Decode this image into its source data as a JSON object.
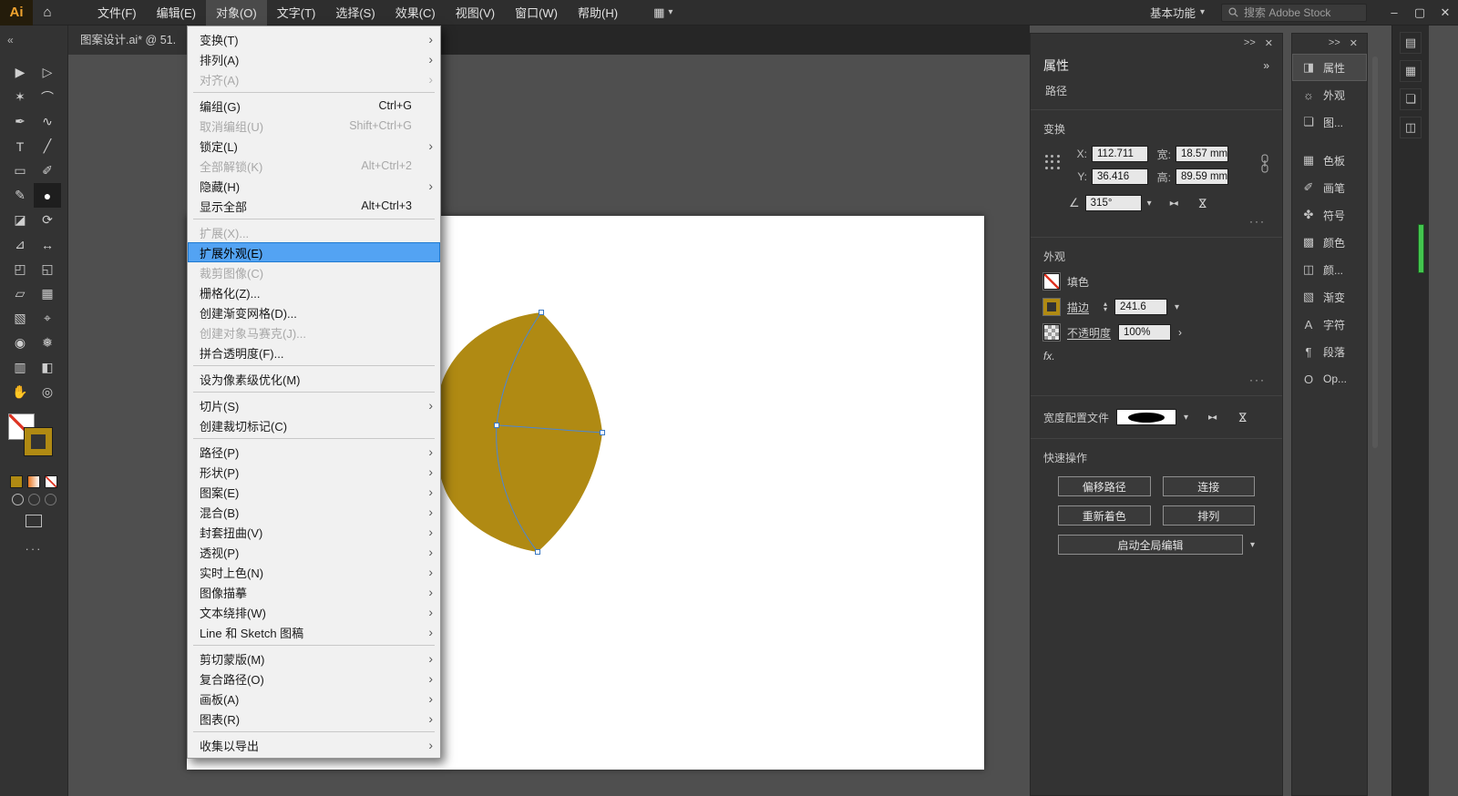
{
  "ui": {
    "caret": "▾",
    "chevron_right": "›",
    "collapse_left": "«",
    "collapse_right": "»",
    "dock_arrows": ">>",
    "close": "✕",
    "more": "···",
    "angle": "∠",
    "flip_h": "▸◂",
    "flip_v": "⋈",
    "stepper_up": "▴",
    "stepper_down": "▾",
    "fx": "fx.",
    "search_icon": "search",
    "submenu_arrow": "›"
  },
  "colors": {
    "shape_gold": "#b08a13",
    "menu_highlight": "#53a3f3",
    "path_blue": "#4a86d8"
  },
  "topbar": {
    "logo": "Ai",
    "home_icon": "⌂",
    "menus": [
      "文件(F)",
      "编辑(E)",
      "对象(O)",
      "文字(T)",
      "选择(S)",
      "效果(C)",
      "视图(V)",
      "窗口(W)",
      "帮助(H)"
    ],
    "open_menu": "对象(O)",
    "arrange_icon": "▦",
    "workspace": "基本功能",
    "search_placeholder": "搜索 Adobe Stock",
    "win_min": "–",
    "win_restore": "▢",
    "win_close": "✕"
  },
  "tabbar": {
    "doc_title": "图案设计.ai* @ 51."
  },
  "object_menu": {
    "items": [
      {
        "label": "变换(T)",
        "submenu": true
      },
      {
        "label": "排列(A)",
        "submenu": true
      },
      {
        "label": "对齐(A)",
        "submenu": true,
        "disabled": true
      },
      {
        "type": "separator"
      },
      {
        "label": "编组(G)",
        "shortcut": "Ctrl+G"
      },
      {
        "label": "取消编组(U)",
        "shortcut": "Shift+Ctrl+G",
        "disabled": true
      },
      {
        "label": "锁定(L)",
        "submenu": true
      },
      {
        "label": "全部解锁(K)",
        "shortcut": "Alt+Ctrl+2",
        "disabled": true
      },
      {
        "label": "隐藏(H)",
        "submenu": true
      },
      {
        "label": "显示全部",
        "shortcut": "Alt+Ctrl+3"
      },
      {
        "type": "separator"
      },
      {
        "label": "扩展(X)...",
        "disabled": true
      },
      {
        "label": "扩展外观(E)",
        "highlighted": true
      },
      {
        "label": "裁剪图像(C)",
        "disabled": true
      },
      {
        "label": "栅格化(Z)..."
      },
      {
        "label": "创建渐变网格(D)..."
      },
      {
        "label": "创建对象马赛克(J)...",
        "disabled": true
      },
      {
        "label": "拼合透明度(F)..."
      },
      {
        "type": "separator"
      },
      {
        "label": "设为像素级优化(M)"
      },
      {
        "type": "separator"
      },
      {
        "label": "切片(S)",
        "submenu": true
      },
      {
        "label": "创建裁切标记(C)"
      },
      {
        "type": "separator"
      },
      {
        "label": "路径(P)",
        "submenu": true
      },
      {
        "label": "形状(P)",
        "submenu": true
      },
      {
        "label": "图案(E)",
        "submenu": true
      },
      {
        "label": "混合(B)",
        "submenu": true
      },
      {
        "label": "封套扭曲(V)",
        "submenu": true
      },
      {
        "label": "透视(P)",
        "submenu": true
      },
      {
        "label": "实时上色(N)",
        "submenu": true
      },
      {
        "label": "图像描摹",
        "submenu": true
      },
      {
        "label": "文本绕排(W)",
        "submenu": true
      },
      {
        "label": "Line 和 Sketch 图稿",
        "submenu": true
      },
      {
        "type": "separator"
      },
      {
        "label": "剪切蒙版(M)",
        "submenu": true
      },
      {
        "label": "复合路径(O)",
        "submenu": true
      },
      {
        "label": "画板(A)",
        "submenu": true
      },
      {
        "label": "图表(R)",
        "submenu": true
      },
      {
        "type": "separator"
      },
      {
        "label": "收集以导出",
        "submenu": true
      }
    ]
  },
  "toolbar": {
    "tools": [
      {
        "name": "selection-tool",
        "glyph": "▶"
      },
      {
        "name": "direct-selection-tool",
        "glyph": "▷"
      },
      {
        "name": "magic-wand-tool",
        "glyph": "✶"
      },
      {
        "name": "lasso-tool",
        "glyph": "⌒"
      },
      {
        "name": "pen-tool",
        "glyph": "✒"
      },
      {
        "name": "curvature-tool",
        "glyph": "∿"
      },
      {
        "name": "type-tool",
        "glyph": "T"
      },
      {
        "name": "line-segment-tool",
        "glyph": "╱"
      },
      {
        "name": "rectangle-tool",
        "glyph": "▭"
      },
      {
        "name": "paintbrush-tool",
        "glyph": "✐"
      },
      {
        "name": "pencil-tool",
        "glyph": "✎"
      },
      {
        "name": "blob-brush-tool",
        "glyph": "●",
        "active": true
      },
      {
        "name": "eraser-tool",
        "glyph": "◪"
      },
      {
        "name": "rotate-tool",
        "glyph": "⟳"
      },
      {
        "name": "scale-tool",
        "glyph": "⊿"
      },
      {
        "name": "width-tool",
        "glyph": "↔"
      },
      {
        "name": "free-transform-tool",
        "glyph": "◰"
      },
      {
        "name": "shape-builder-tool",
        "glyph": "◱"
      },
      {
        "name": "perspective-grid-tool",
        "glyph": "▱"
      },
      {
        "name": "mesh-tool",
        "glyph": "▦"
      },
      {
        "name": "gradient-tool",
        "glyph": "▧"
      },
      {
        "name": "eyedropper-tool",
        "glyph": "⌖"
      },
      {
        "name": "blend-tool",
        "glyph": "◉"
      },
      {
        "name": "symbol-sprayer-tool",
        "glyph": "❅"
      },
      {
        "name": "column-graph-tool",
        "glyph": "▥"
      },
      {
        "name": "artboard-tool",
        "glyph": "◧"
      },
      {
        "name": "hand-tool",
        "glyph": "✋"
      },
      {
        "name": "zoom-tool",
        "glyph": "◎"
      }
    ]
  },
  "properties": {
    "title": "属性",
    "selection_type": "路径",
    "transform": {
      "title": "变换",
      "x_label": "X:",
      "x": "112.711",
      "y_label": "Y:",
      "y": "36.416",
      "w_label": "宽:",
      "w": "18.57 mm",
      "h_label": "高:",
      "h": "89.59 mm",
      "angle": "315°"
    },
    "appearance": {
      "title": "外观",
      "fill_label": "填色",
      "stroke_label": "描边",
      "stroke_weight": "241.6",
      "opacity_label": "不透明度",
      "opacity": "100%"
    },
    "width_profile_label": "宽度配置文件",
    "quick_title": "快速操作",
    "quick_buttons": [
      {
        "name": "offset-path",
        "label": "偏移路径"
      },
      {
        "name": "join",
        "label": "连接"
      },
      {
        "name": "recolor",
        "label": "重新着色"
      },
      {
        "name": "arrange",
        "label": "排列"
      },
      {
        "name": "start-global-edit",
        "label": "启动全局编辑"
      }
    ]
  },
  "panel_tabs": {
    "items": [
      {
        "name": "tab-properties",
        "label": "属性",
        "icon": "◨",
        "active": true
      },
      {
        "name": "tab-appearance",
        "label": "外观",
        "icon": "☼"
      },
      {
        "name": "tab-layers",
        "label": "图...",
        "icon": "❏"
      },
      {
        "name": "tab-swatches",
        "label": "色板",
        "icon": "▦"
      },
      {
        "name": "tab-brushes",
        "label": "画笔",
        "icon": "✐"
      },
      {
        "name": "tab-symbols",
        "label": "符号",
        "icon": "✤"
      },
      {
        "name": "tab-color",
        "label": "颜色",
        "icon": "▩"
      },
      {
        "name": "tab-color-guide",
        "label": "颜...",
        "icon": "◫"
      },
      {
        "name": "tab-gradient",
        "label": "渐变",
        "icon": "▧"
      },
      {
        "name": "tab-character",
        "label": "字符",
        "icon": "A"
      },
      {
        "name": "tab-paragraph",
        "label": "段落",
        "icon": "¶"
      },
      {
        "name": "tab-opentype",
        "label": "Op...",
        "icon": "O"
      }
    ]
  },
  "right_rail": {
    "icons": [
      {
        "name": "collapsed-panel-icon-1",
        "glyph": "▤"
      },
      {
        "name": "collapsed-panel-icon-2",
        "glyph": "▦"
      },
      {
        "name": "collapsed-panel-icon-3",
        "glyph": "❏"
      },
      {
        "name": "collapsed-panel-icon-4",
        "glyph": "◫"
      }
    ]
  }
}
